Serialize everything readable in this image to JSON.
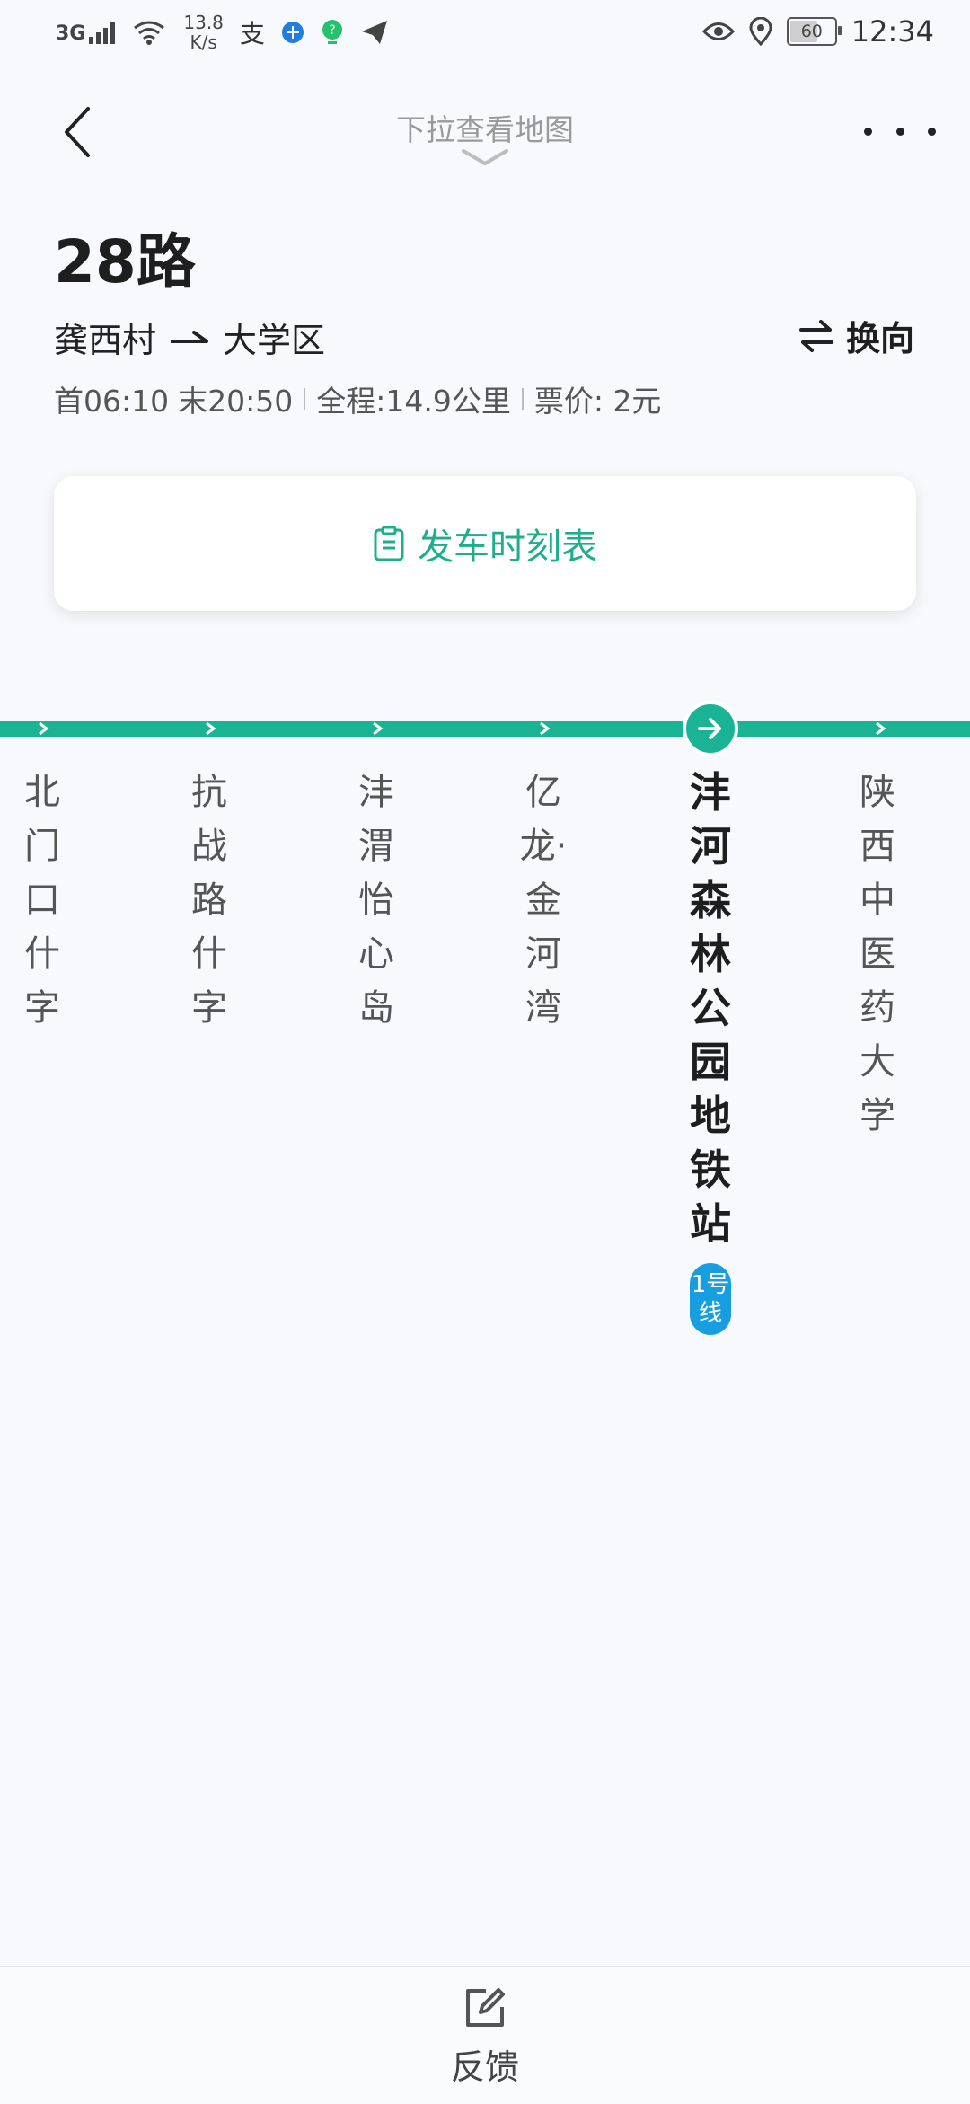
{
  "status_bar": {
    "network": "3G",
    "speed_value": "13.8",
    "speed_unit": "K/s",
    "battery": "60",
    "time": "12:34",
    "left_icons": [
      "alipay-icon",
      "browser-icon",
      "assistant-icon",
      "paper-plane-icon"
    ],
    "right_icons": [
      "eye-icon",
      "location-pin-icon"
    ]
  },
  "header": {
    "pull_hint": "下拉查看地图"
  },
  "route": {
    "name": "28路",
    "from": "龚西村",
    "to": "大学区",
    "swap_label": "换向",
    "first_bus": "首06:10",
    "last_bus": "末20:50",
    "distance": "全程:14.9公里",
    "fare": "票价: 2元"
  },
  "timetable": {
    "label": "发车时刻表"
  },
  "stations": [
    {
      "name": "北门口什字",
      "current": false
    },
    {
      "name": "抗战路什字",
      "current": false
    },
    {
      "name": "沣渭怡心岛",
      "current": false
    },
    {
      "name": "亿龙·金河湾",
      "current": false
    },
    {
      "name": "沣河森林公园地铁站",
      "current": true,
      "badge": "1号线"
    },
    {
      "name": "陕西中医药大学",
      "current": false
    }
  ],
  "colors": {
    "accent": "#1ab494",
    "metro_badge": "#179ee0"
  },
  "footer": {
    "feedback_label": "反馈"
  }
}
